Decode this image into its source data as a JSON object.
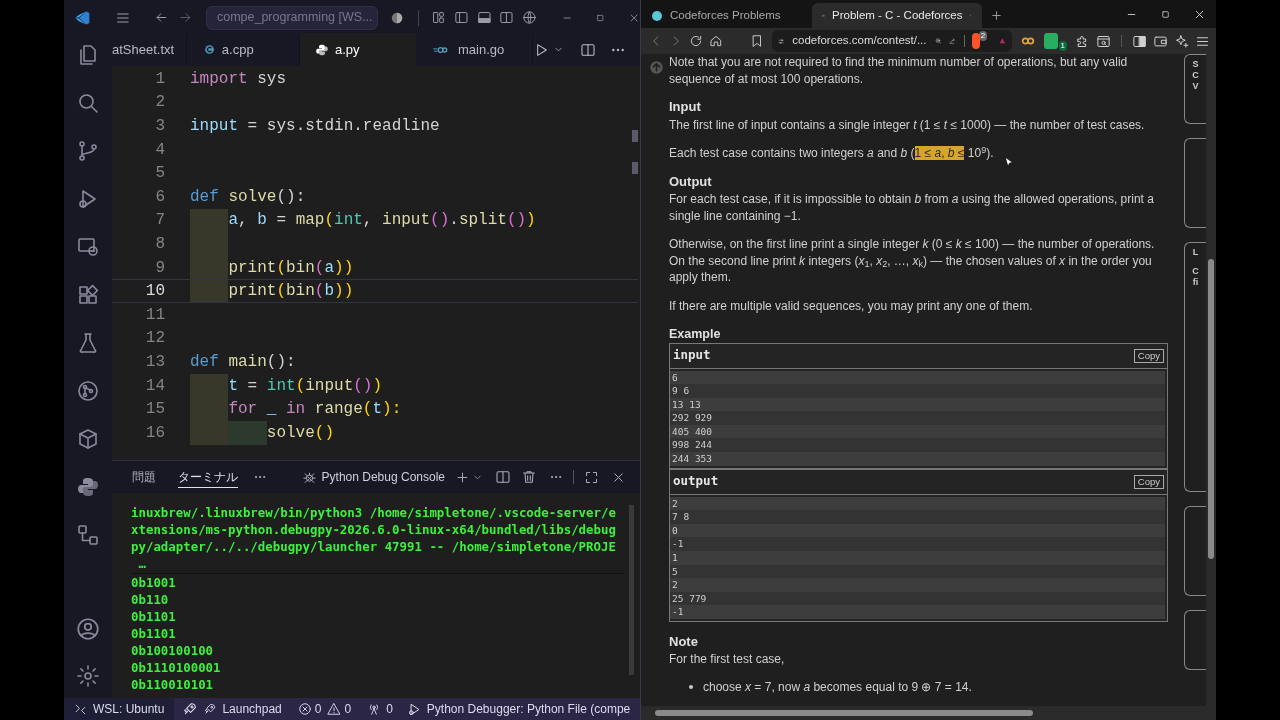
{
  "vscode": {
    "command_center": "compe_programming [WS...",
    "tabs": [
      {
        "label": "atSheet.txt",
        "kind": "txt",
        "selected": false
      },
      {
        "label": "a.cpp",
        "kind": "cpp",
        "selected": false
      },
      {
        "label": "a.py",
        "kind": "py",
        "selected": true
      },
      {
        "label": "main.go",
        "kind": "go",
        "selected": false
      }
    ],
    "editor": {
      "lines": [
        {
          "number": "1",
          "current": false,
          "tokens": [
            {
              "text": "import ",
              "kind": "ctrl"
            },
            {
              "text": "sys",
              "kind": "plain"
            }
          ]
        },
        {
          "number": "2",
          "current": false
        },
        {
          "number": "3",
          "current": false,
          "tokens": [
            {
              "text": "input",
              "kind": "var"
            },
            {
              "text": " = sys.stdin.readline",
              "kind": "plain"
            }
          ]
        },
        {
          "number": "4",
          "current": false
        },
        {
          "number": "5",
          "current": false
        },
        {
          "number": "6",
          "current": false,
          "tokens": [
            {
              "text": "def ",
              "kind": "kw"
            },
            {
              "text": "solve",
              "kind": "fn"
            },
            {
              "text": "():",
              "kind": "plain"
            }
          ]
        },
        {
          "number": "7",
          "current": false,
          "indents": [
            {
              "kind": "outer"
            }
          ],
          "tokens": [
            {
              "text": "a",
              "kind": "var"
            },
            {
              "text": ", ",
              "kind": "plain"
            },
            {
              "text": "b",
              "kind": "var"
            },
            {
              "text": " = ",
              "kind": "plain"
            },
            {
              "text": "map",
              "kind": "fn"
            },
            {
              "text": "(",
              "kind": "p1"
            },
            {
              "text": "int",
              "kind": "cls"
            },
            {
              "text": ", ",
              "kind": "plain"
            },
            {
              "text": "input",
              "kind": "fn"
            },
            {
              "text": "()",
              "kind": "p2"
            },
            {
              "text": ".",
              "kind": "plain"
            },
            {
              "text": "split",
              "kind": "fn"
            },
            {
              "text": "()",
              "kind": "p2"
            },
            {
              "text": ")",
              "kind": "p1"
            }
          ]
        },
        {
          "number": "8",
          "current": false,
          "indents": [
            {
              "kind": "outer"
            }
          ]
        },
        {
          "number": "9",
          "current": false,
          "indents": [
            {
              "kind": "outer"
            }
          ],
          "tokens": [
            {
              "text": "print",
              "kind": "fn"
            },
            {
              "text": "(",
              "kind": "p1"
            },
            {
              "text": "bin",
              "kind": "fn"
            },
            {
              "text": "(",
              "kind": "p2"
            },
            {
              "text": "a",
              "kind": "var"
            },
            {
              "text": "))",
              "kind": "p1"
            }
          ]
        },
        {
          "number": "10",
          "current": true,
          "indents": [
            {
              "kind": "outer"
            }
          ],
          "tokens": [
            {
              "text": "print",
              "kind": "fn"
            },
            {
              "text": "(",
              "kind": "p1"
            },
            {
              "text": "bin",
              "kind": "fn"
            },
            {
              "text": "(",
              "kind": "p2"
            },
            {
              "text": "b",
              "kind": "var"
            },
            {
              "text": "))",
              "kind": "p1"
            }
          ]
        },
        {
          "number": "11",
          "current": false
        },
        {
          "number": "12",
          "current": false
        },
        {
          "number": "13",
          "current": false,
          "tokens": [
            {
              "text": "def ",
              "kind": "kw"
            },
            {
              "text": "main",
              "kind": "fn"
            },
            {
              "text": "():",
              "kind": "plain"
            }
          ]
        },
        {
          "number": "14",
          "current": false,
          "indents": [
            {
              "kind": "outer"
            }
          ],
          "tokens": [
            {
              "text": "t",
              "kind": "var"
            },
            {
              "text": " = ",
              "kind": "plain"
            },
            {
              "text": "int",
              "kind": "cls"
            },
            {
              "text": "(",
              "kind": "p1"
            },
            {
              "text": "input",
              "kind": "fn"
            },
            {
              "text": "()",
              "kind": "p2"
            },
            {
              "text": ")",
              "kind": "p1"
            }
          ]
        },
        {
          "number": "15",
          "current": false,
          "indents": [
            {
              "kind": "outer"
            }
          ],
          "tokens": [
            {
              "text": "for ",
              "kind": "ctrl"
            },
            {
              "text": "_ ",
              "kind": "var"
            },
            {
              "text": "in ",
              "kind": "ctrl"
            },
            {
              "text": "range",
              "kind": "fn"
            },
            {
              "text": "(",
              "kind": "p1"
            },
            {
              "text": "t",
              "kind": "var"
            },
            {
              "text": "):",
              "kind": "p1"
            }
          ]
        },
        {
          "number": "16",
          "current": false,
          "indents": [
            {
              "kind": "outer"
            },
            {
              "kind": "inner"
            }
          ],
          "tokens": [
            {
              "text": "solve",
              "kind": "fn"
            },
            {
              "text": "()",
              "kind": "p1"
            }
          ]
        }
      ]
    },
    "panel": {
      "tabs": [
        {
          "label": "問題",
          "selected": false
        },
        {
          "label": "ターミナル",
          "selected": true
        }
      ],
      "terminal_name": "Python Debug Console",
      "command_lines": [
        "inuxbrew/.linuxbrew/bin/python3 /home/simpletone/.vscode-server/e",
        "xtensions/ms-python.debugpy-2026.6.0-linux-x64/bundled/libs/debug",
        "py/adapter/../../debugpy/launcher 47991 -- /home/simpletone/PROJE",
        " …"
      ],
      "output_lines": [
        "0b1001",
        "0b110",
        "0b1101",
        "0b1101",
        "0b100100100",
        "0b1110100001",
        "0b110010101"
      ]
    },
    "status_bar": {
      "remote": "WSL: Ubuntu",
      "launchpad": "Launchpad",
      "errors": "0",
      "warnings": "0",
      "ports": "0",
      "debugger": "Python Debugger: Python File (compe"
    }
  },
  "browser": {
    "tabs": [
      {
        "label": "Codeforces Problems",
        "selected": false
      },
      {
        "label": "Problem - C - Codeforces",
        "selected": true
      }
    ],
    "url": "codeforces.com/contest/...",
    "shield_count": "2",
    "extension_count": "1",
    "problem": {
      "intro": "Note that you are not required to find the minimum number of operations, but any valid sequence of at most 100 operations.",
      "sections": [
        {
          "heading": "Input",
          "paragraphs": [
            [
              {
                "text": "The first line of input contains a single integer *t* (1 ≤ *t* ≤ 1000) — the number of test cases.",
                "highlighted": false
              }
            ],
            [
              {
                "text": "Each test case contains two integers *a* and *b* (",
                "highlighted": false
              },
              {
                "text": "1 ≤ *a*, *b* ≤",
                "highlighted": true
              },
              {
                "text": " 10$^{9}$).",
                "highlighted": false
              }
            ]
          ]
        },
        {
          "heading": "Output",
          "paragraphs": [
            [
              {
                "text": "For each test case, if it is impossible to obtain *b* from *a* using the allowed operations, print a single line containing −1.",
                "highlighted": false
              }
            ],
            [
              {
                "text": "Otherwise, on the first line print a single integer *k* (0 ≤ *k* ≤ 100) — the number of operations. On the second line print *k* integers (*x*$_{1}$, *x*$_{2}$, …, *x*$_{k}$) — the chosen values of *x* in the order you apply them.",
                "highlighted": false
              }
            ],
            [
              {
                "text": "If there are multiple valid sequences, you may print any one of them.",
                "highlighted": false
              }
            ]
          ]
        }
      ],
      "example": {
        "heading": "Example",
        "blocks": [
          {
            "title": "input",
            "copy": "Copy",
            "lines": [
              "6",
              "9 6",
              "13 13",
              "292 929",
              "405 400",
              "998 244",
              "244 353"
            ]
          },
          {
            "title": "output",
            "copy": "Copy",
            "lines": [
              "2",
              "7 8",
              "0",
              "-1",
              "1",
              "5",
              "2",
              "25 779",
              "-1"
            ]
          }
        ]
      },
      "note": {
        "heading": "Note",
        "text": "For the first test case,",
        "bullets": [
          "choose *x* = 7, now *a* becomes equal to 9 ⊕ 7 = 14."
        ]
      },
      "sidebar_cards": [
        {
          "kind": "text",
          "texts": [
            "S",
            "C",
            "V"
          ]
        },
        {
          "kind": "blank"
        },
        {
          "kind": "text",
          "texts": [
            "L",
            "C",
            "fi"
          ]
        },
        {
          "kind": "blank"
        },
        {
          "kind": "blank"
        }
      ]
    }
  }
}
